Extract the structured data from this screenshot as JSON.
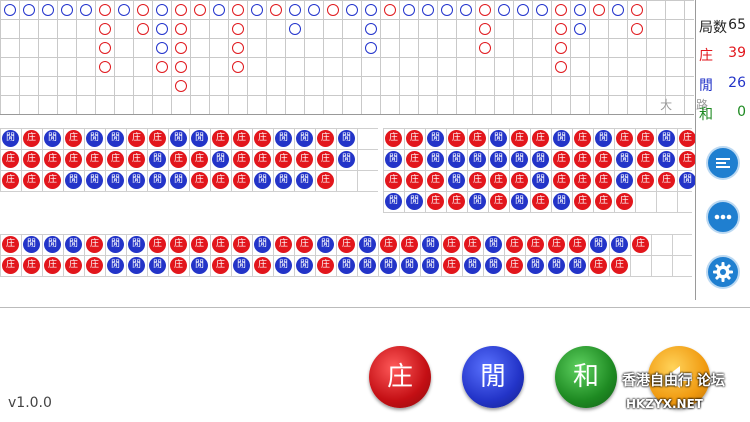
{
  "big_road": {
    "label": "大 路",
    "columns": [
      [
        "B"
      ],
      [
        "B"
      ],
      [
        "B"
      ],
      [
        "B"
      ],
      [
        "B"
      ],
      [
        "R",
        "R",
        "R",
        "R"
      ],
      [
        "B"
      ],
      [
        "R",
        "R"
      ],
      [
        "B",
        "B",
        "B",
        "R"
      ],
      [
        "R",
        "R",
        "R",
        "R",
        "R"
      ],
      [
        "R"
      ],
      [
        "B"
      ],
      [
        "R",
        "R",
        "R",
        "R"
      ],
      [
        "B"
      ],
      [
        "R"
      ],
      [
        "B",
        "B"
      ],
      [
        "B"
      ],
      [
        "R"
      ],
      [
        "B"
      ],
      [
        "B",
        "B",
        "B"
      ],
      [
        "R"
      ],
      [
        "B"
      ],
      [
        "B"
      ],
      [
        "B"
      ],
      [
        "B"
      ],
      [
        "R",
        "R",
        "R"
      ],
      [
        "B"
      ],
      [
        "B"
      ],
      [
        "B"
      ],
      [
        "R",
        "R",
        "R",
        "R"
      ],
      [
        "B",
        "B"
      ],
      [
        "R"
      ],
      [
        "B"
      ],
      [
        "R",
        "R"
      ]
    ]
  },
  "bead_plates": [
    {
      "rows": [
        [
          "閒",
          "庄",
          "閒",
          "庄",
          "閒",
          "閒",
          "庄",
          "庄",
          "閒",
          "閒",
          "庄",
          "庄",
          "庄",
          "閒",
          "閒",
          "庄",
          "閒"
        ],
        [
          "庄",
          "庄",
          "庄",
          "庄",
          "庄",
          "庄",
          "庄",
          "閒",
          "庄",
          "庄",
          "閒",
          "庄",
          "庄",
          "庄",
          "庄",
          "庄",
          "閒"
        ],
        [
          "庄",
          "庄",
          "庄",
          "閒",
          "閒",
          "閒",
          "閒",
          "閒",
          "閒",
          "庄",
          "庄",
          "庄",
          "閒",
          "閒",
          "閒",
          "庄"
        ]
      ]
    },
    {
      "rows": [
        [
          "庄",
          "庄",
          "閒",
          "庄",
          "庄",
          "閒",
          "庄",
          "庄",
          "閒",
          "庄",
          "閒",
          "庄",
          "庄",
          "閒",
          "庄"
        ],
        [
          "閒",
          "庄",
          "閒",
          "閒",
          "閒",
          "閒",
          "閒",
          "閒",
          "庄",
          "庄",
          "庄",
          "閒",
          "庄",
          "閒",
          "庄"
        ],
        [
          "庄",
          "庄",
          "庄",
          "閒",
          "庄",
          "庄",
          "庄",
          "閒",
          "庄",
          "庄",
          "庄",
          "閒",
          "庄",
          "庄",
          "閒"
        ],
        [
          "閒",
          "閒",
          "庄",
          "庄",
          "閒",
          "庄",
          "閒",
          "庄",
          "閒",
          "庄",
          "庄",
          "庄"
        ]
      ]
    },
    {
      "rows": [
        [
          "庄",
          "閒",
          "閒",
          "閒",
          "庄",
          "閒",
          "閒",
          "庄",
          "庄",
          "庄",
          "庄",
          "庄",
          "閒",
          "庄",
          "庄",
          "閒",
          "庄",
          "閒",
          "庄",
          "庄",
          "閒",
          "庄",
          "庄",
          "閒",
          "庄",
          "庄",
          "庄",
          "庄",
          "閒",
          "閒",
          "庄"
        ],
        [
          "庄",
          "庄",
          "庄",
          "庄",
          "庄",
          "閒",
          "閒",
          "閒",
          "庄",
          "閒",
          "庄",
          "閒",
          "庄",
          "閒",
          "閒",
          "庄",
          "閒",
          "閒",
          "閒",
          "閒",
          "閒",
          "庄",
          "閒",
          "閒",
          "庄",
          "閒",
          "閒",
          "閒",
          "庄",
          "庄"
        ]
      ]
    }
  ],
  "stats": {
    "rounds_label": "局数",
    "rounds_value": "65",
    "banker_label": "庄",
    "banker_value": "39",
    "player_label": "閒",
    "player_value": "26",
    "tie_label": "和",
    "tie_value": "0"
  },
  "menu": {
    "list_icon": "list-icon",
    "more_icon": "more-dots-icon",
    "settings_icon": "gear-icon"
  },
  "controls": {
    "banker": "庄",
    "player": "閒",
    "tie": "和"
  },
  "version": "v1.0.0",
  "watermark": {
    "line1": "香港自由行 论坛",
    "line2": "HKZYX.NET"
  },
  "colors": {
    "banker": "#e2161c",
    "player": "#2334c8",
    "tie": "#1e8a22",
    "accent": "#1f7fd0"
  }
}
